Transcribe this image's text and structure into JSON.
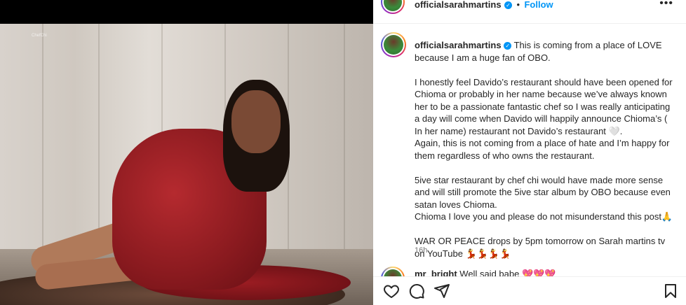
{
  "post": {
    "username": "officialsarahmartins",
    "follow_label": "Follow",
    "header_separator": "•",
    "more_icon": "more-horizontal-icon",
    "photo_watermark": "ChefChi"
  },
  "caption": {
    "username": "officialsarahmartins",
    "paragraphs": [
      "This is coming from a place of LOVE because I am a huge fan of OBO.",
      "I honestly feel Davido’s restaurant should have been opened for Chioma or probably in her name because we’ve always known her to be a passionate fantastic chef so I was really anticipating a day will come when Davido will happily announce Chioma’s ( In her name) restaurant not Davido’s restaurant 🤍.",
      "Again, this is not coming from a place of hate and I’m happy for them regardless of who owns the restaurant.",
      "5ive star restaurant by chef chi would have made more sense and will still promote the 5ive star album by OBO because even satan loves Chioma.",
      "Chioma I love you and please do not misunderstand this post🙏",
      "WAR OR PEACE drops by 5pm tomorrow on Sarah martins tv on YouTube 💃💃💃💃"
    ],
    "timestamp": "16h"
  },
  "comment_preview": {
    "username": "mr_bright",
    "text": "Well said babe 💖💖💖"
  },
  "actions": {
    "like_icon": "heart-icon",
    "comment_icon": "comment-icon",
    "save_icon": "bookmark-icon"
  },
  "colors": {
    "accent": "#0095f6",
    "text": "#262626",
    "muted": "#737373"
  }
}
